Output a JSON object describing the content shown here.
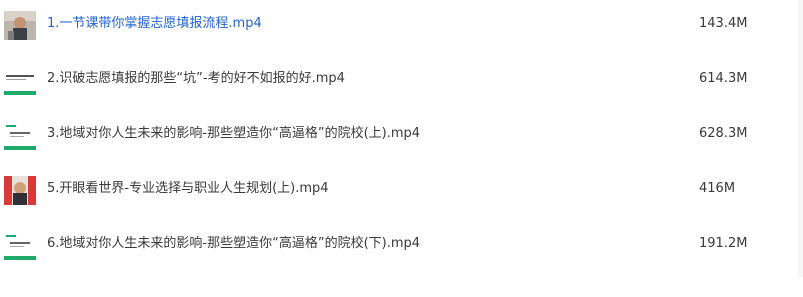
{
  "files": [
    {
      "name": "1.一节课带你掌握志愿填报流程.mp4",
      "size": "143.4M",
      "thumbnail": "person-video-thumbnail",
      "selected": true
    },
    {
      "name": "2.识破志愿填报的那些“坑”-考的好不如报的好.mp4",
      "size": "614.3M",
      "thumbnail": "text-slide-thumbnail",
      "selected": false
    },
    {
      "name": "3.地域对你人生未来的影响-那些塑造你“高逼格”的院校(上).mp4",
      "size": "628.3M",
      "thumbnail": "green-slide-thumbnail",
      "selected": false
    },
    {
      "name": "5.开眼看世界-专业选择与职业人生规划(上).mp4",
      "size": "416M",
      "thumbnail": "person-red-video-thumbnail",
      "selected": false
    },
    {
      "name": "6.地域对你人生未来的影响-那些塑造你“高逼格”的院校(下).mp4",
      "size": "191.2M",
      "thumbnail": "green-slide-thumbnail",
      "selected": false
    }
  ],
  "colors": {
    "selected_text": "#1f63d6",
    "text": "#3a3a3a",
    "thumbnail_green": "#1eaa6b"
  }
}
